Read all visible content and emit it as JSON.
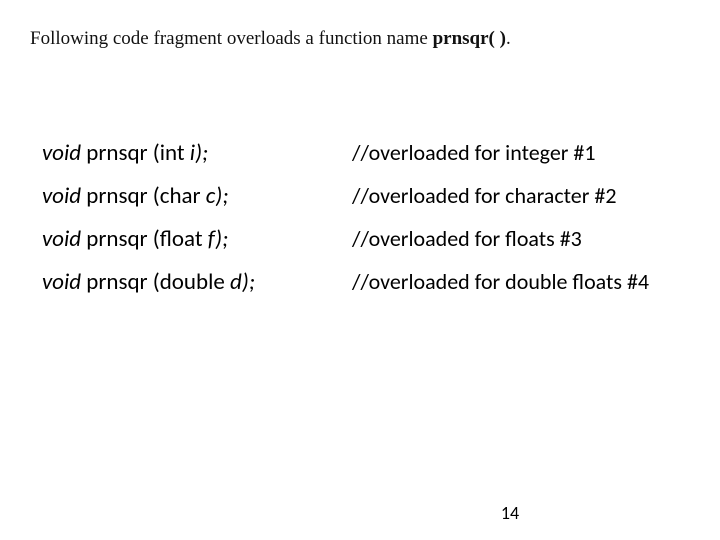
{
  "intro": {
    "prefix": "Following code fragment overloads a function name ",
    "fn": "prnsqr( )",
    "suffix": "."
  },
  "rows": [
    {
      "kw": "void",
      "name": " prnsqr (int ",
      "param": "i",
      "tail": ");",
      "comment": "//overloaded for integer #1"
    },
    {
      "kw": "void",
      "name": " prnsqr (char ",
      "param": "c",
      "tail": ");",
      "comment": "//overloaded for character #2"
    },
    {
      "kw": "void",
      "name": " prnsqr (float ",
      "param": "f",
      "tail": ");",
      "comment": "//overloaded for floats #3"
    },
    {
      "kw": "void",
      "name": " prnsqr (double ",
      "param": "d",
      "tail": ");",
      "comment": "//overloaded for double floats #4"
    }
  ],
  "page_number": "14"
}
